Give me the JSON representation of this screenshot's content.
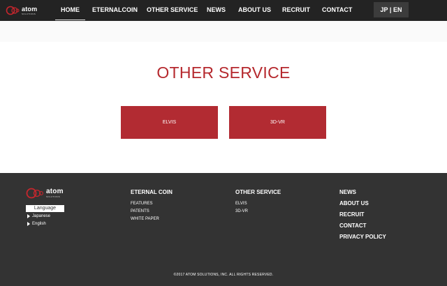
{
  "header": {
    "logo_word": "atom",
    "logo_sub": "SOLUTIONS",
    "nav": [
      {
        "label": "HOME",
        "active": true
      },
      {
        "label": "ETERNALCOIN"
      },
      {
        "label": "OTHER SERVICE"
      },
      {
        "label": "NEWS"
      },
      {
        "label": "ABOUT US"
      },
      {
        "label": "RECRUIT"
      },
      {
        "label": "CONTACT"
      }
    ],
    "lang_jp": "JP",
    "lang_sep": " | ",
    "lang_en": "EN"
  },
  "main": {
    "title": "OTHER SERVICE",
    "buttons": [
      {
        "label": "ELVIS"
      },
      {
        "label": "3D-VR"
      }
    ]
  },
  "footer": {
    "logo_word": "atom",
    "logo_sub": "SOLUTIONS",
    "language_label": "Language",
    "languages": [
      "Japanese",
      "English"
    ],
    "columns": [
      {
        "heading": "ETERNAL COIN",
        "links": [
          "FEATURES",
          "PATENTS",
          "WHITE PAPER"
        ]
      },
      {
        "heading": "OTHER SERVICE",
        "links": [
          "ELVIS",
          "3D-VR"
        ]
      }
    ],
    "right_links": [
      "NEWS",
      "ABOUT US",
      "RECRUIT",
      "CONTACT",
      "PRIVACY POLICY"
    ],
    "copyright": "©2017 ATOM SOLUTIONS, INC. ALL RIGHTS RESERVED."
  },
  "colors": {
    "brand_red": "#b22b32",
    "nav_bg": "#232323",
    "footer_bg": "#333333"
  }
}
